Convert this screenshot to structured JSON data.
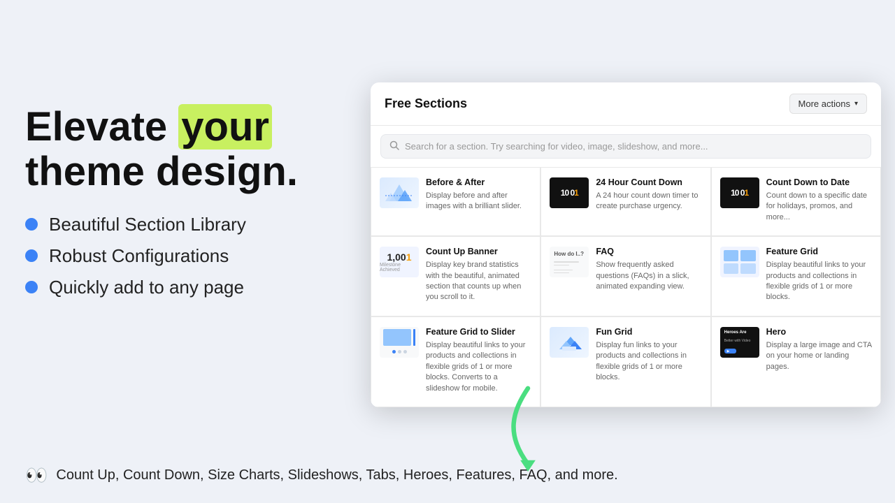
{
  "page": {
    "background": "#eef1f7"
  },
  "left": {
    "headline_part1": "Elevate ",
    "headline_highlight": "your",
    "headline_part2": "theme design.",
    "bullets": [
      "Beautiful Section Library",
      "Robust Configurations",
      "Quickly add to any page"
    ],
    "bottom_text": "Count Up, Count Down, Size Charts, Slideshows, Tabs, Heroes, Features, FAQ, and more."
  },
  "modal": {
    "title": "Free Sections",
    "more_actions_label": "More actions",
    "search_placeholder": "Search for a section. Try searching for video, image, slideshow, and more...",
    "sections": [
      {
        "name": "Before & After",
        "desc": "Display before and after images with a brilliant slider.",
        "thumb_type": "mountain"
      },
      {
        "name": "24 Hour Count Down",
        "desc": "A 24 hour count down timer to create purchase urgency.",
        "thumb_type": "countdown"
      },
      {
        "name": "Count Down to Date",
        "desc": "Count down to a specific date for holidays, promos, and more...",
        "thumb_type": "countdown"
      },
      {
        "name": "Count Up Banner",
        "desc": "Display key brand statistics with the beautiful, animated section that counts up when you scroll to it.",
        "thumb_type": "countup"
      },
      {
        "name": "FAQ",
        "desc": "Show frequently asked questions (FAQs) in a slick, animated expanding view.",
        "thumb_type": "faq"
      },
      {
        "name": "Feature Grid",
        "desc": "Display beautiful links to your products and collections in flexible grids of 1 or more blocks.",
        "thumb_type": "grid"
      },
      {
        "name": "Feature Grid to Slider",
        "desc": "Display beautiful links to your products and collections in flexible grids of 1 or more blocks. Converts to a slideshow for mobile.",
        "thumb_type": "slider"
      },
      {
        "name": "Fun Grid",
        "desc": "Display fun links to your products and collections in flexible grids of 1 or more blocks.",
        "thumb_type": "fun-grid"
      },
      {
        "name": "Hero",
        "desc": "Display a large image and CTA on your home or landing pages.",
        "thumb_type": "hero"
      }
    ]
  }
}
